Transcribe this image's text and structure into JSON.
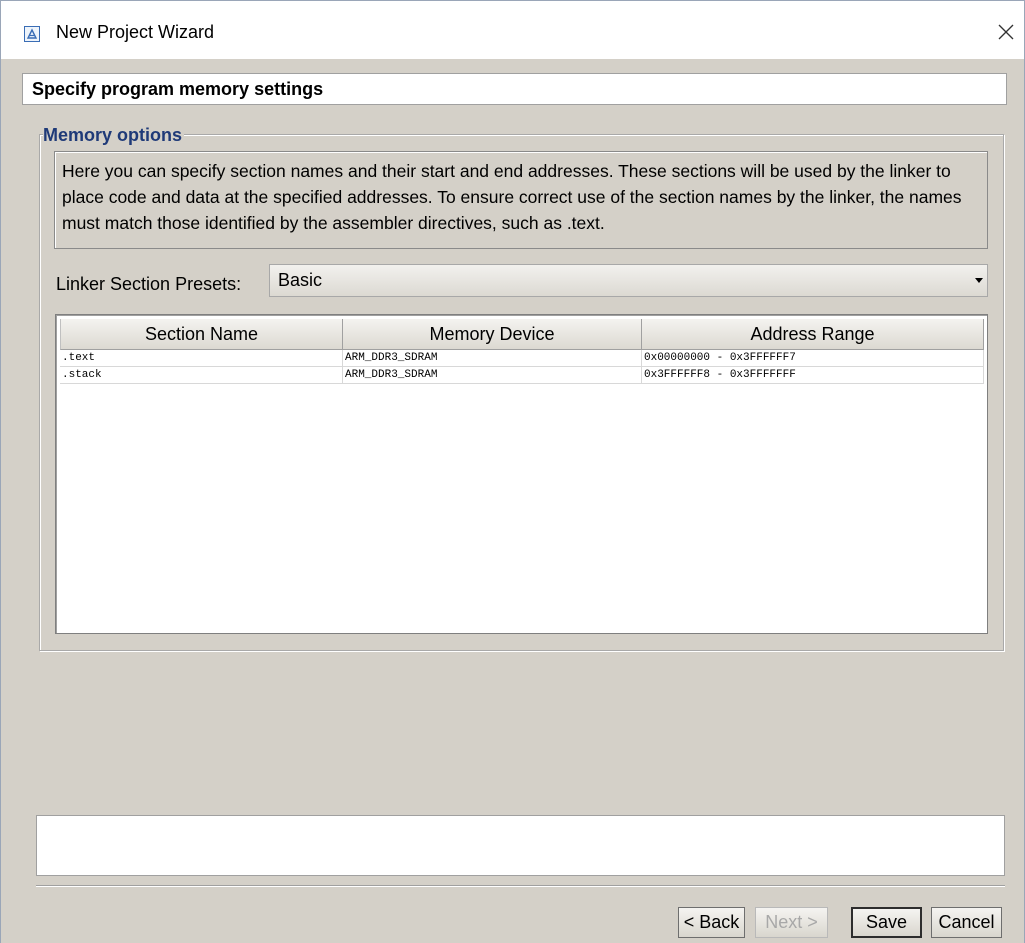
{
  "window": {
    "title": "New Project Wizard"
  },
  "header": {
    "title": "Specify program memory settings"
  },
  "memory_options": {
    "legend": "Memory options",
    "description": "Here you can specify section names and their start and end addresses. These sections will be used by the linker to place code and data at the specified addresses. To ensure correct use of the section names by the linker, the names must match those identified by the assembler directives, such as .text.",
    "preset_label": "Linker Section Presets:",
    "preset_value": "Basic"
  },
  "sections_table": {
    "columns": [
      "Section Name",
      "Memory Device",
      "Address Range"
    ],
    "rows": [
      [
        ".text",
        "ARM_DDR3_SDRAM",
        "0x00000000 - 0x3FFFFFF7"
      ],
      [
        ".stack",
        "ARM_DDR3_SDRAM",
        "0x3FFFFFF8 - 0x3FFFFFFF"
      ]
    ]
  },
  "status": {
    "message": ""
  },
  "buttons": {
    "back": "< Back",
    "next": "Next >",
    "save": "Save",
    "cancel": "Cancel"
  }
}
